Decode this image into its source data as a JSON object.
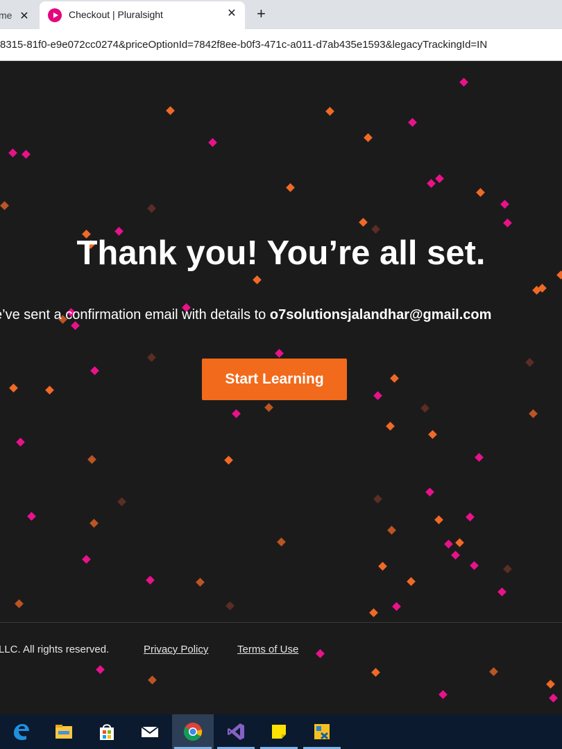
{
  "browser": {
    "prev_tab_label": "me",
    "prev_tab_close": "✕",
    "active_tab_title": "Checkout | Pluralsight",
    "active_tab_close": "✕",
    "new_tab": "+",
    "url": "8315-81f0-e9e072cc0274&priceOptionId=7842f8ee-b0f3-471c-a011-d7ab435e1593&legacyTrackingId=IN"
  },
  "page": {
    "headline": "Thank you! You’re all set.",
    "confirmation_prefix": "e’ve sent a confirmation email with details to ",
    "email": "o7solutionsjalandhar@gmail.com",
    "cta_label": "Start Learning",
    "footer_copyright": "LLC. All rights reserved.",
    "privacy_link": "Privacy Policy",
    "terms_link": "Terms of Use"
  },
  "colors": {
    "background": "#1c1b1c",
    "cta": "#f26a1b",
    "confetti_orange": "#f06a26",
    "confetti_pink": "#e8128a",
    "confetti_dim": "#5a2e24"
  },
  "taskbar": {
    "icons": [
      "edge-icon",
      "file-explorer-icon",
      "store-icon",
      "mail-icon",
      "chrome-icon",
      "visual-studio-icon",
      "sticky-notes-icon",
      "network-tool-icon"
    ]
  }
}
